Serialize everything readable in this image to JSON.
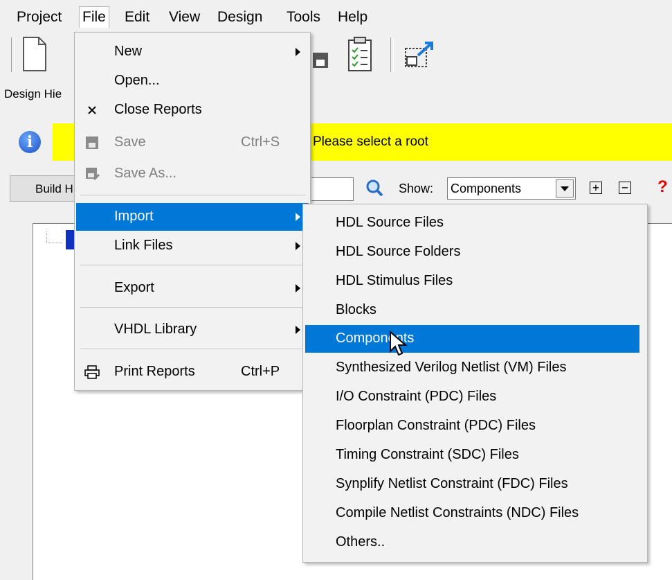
{
  "menubar": [
    "Project",
    "File",
    "Edit",
    "View",
    "Design",
    "Tools",
    "Help"
  ],
  "design_hierarchy_label": "Design Hie",
  "message": "Please select a root",
  "build_button": "Build H",
  "show_label": "Show:",
  "show_value": "Components",
  "tree_plus": "+",
  "tree_minus": "−",
  "help": "?",
  "file_menu": {
    "new": "New",
    "open": "Open...",
    "close_reports": "Close Reports",
    "save": "Save",
    "save_shortcut": "Ctrl+S",
    "save_as": "Save As...",
    "import": "Import",
    "link_files": "Link Files",
    "export": "Export",
    "vhdl_library": "VHDL Library",
    "print_reports": "Print Reports",
    "print_shortcut": "Ctrl+P"
  },
  "import_submenu": [
    "HDL Source Files",
    "HDL Source Folders",
    "HDL Stimulus Files",
    "Blocks",
    "Components",
    "Synthesized Verilog Netlist (VM) Files",
    "I/O Constraint (PDC) Files",
    "Floorplan Constraint (PDC) Files",
    "Timing Constraint (SDC) Files",
    "Synplify Netlist Constraint (FDC) Files",
    "Compile Netlist Constraints (NDC) Files",
    "Others.."
  ],
  "colors": {
    "highlight": "#0078d7",
    "message_bg": "#ffff00"
  },
  "icons": [
    "new-file-icon",
    "open-folder-icon",
    "save-icon",
    "report-icon",
    "checklist-icon",
    "window-icon",
    "info-icon",
    "magnifier-icon",
    "close-icon",
    "printer-icon",
    "mouse-cursor-icon"
  ]
}
